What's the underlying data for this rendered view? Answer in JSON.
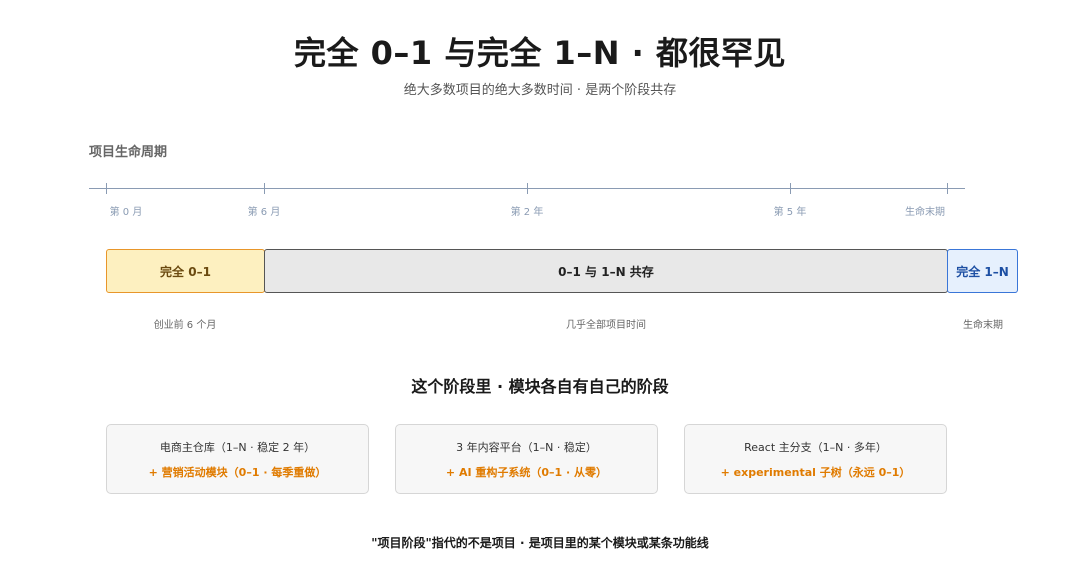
{
  "header": {
    "title": "完全 0–1 与完全 1–N · 都很罕见",
    "subtitle": "绝大多数项目的绝大多数时间 · 是两个阶段共存"
  },
  "timeline": {
    "label": "项目生命周期",
    "ticks": [
      "第 0 月",
      "第 6 月",
      "第 2 年",
      "第 5 年",
      "生命末期"
    ]
  },
  "phases": [
    {
      "label": "完全 0–1",
      "caption": "创业前 6 个月"
    },
    {
      "label": "0–1 与 1–N 共存",
      "caption": "几乎全部项目时间"
    },
    {
      "label": "完全 1–N",
      "caption": "生命末期"
    }
  ],
  "modules": {
    "heading": "这个阶段里 · 模块各自有自己的阶段",
    "cards": [
      {
        "line1": "电商主仓库（1–N · 稳定 2 年）",
        "line2": "+ 营销活动模块（0–1 · 每季重做）"
      },
      {
        "line1": "3 年内容平台（1–N · 稳定）",
        "line2": "+ AI 重构子系统（0–1 · 从零）"
      },
      {
        "line1": "React 主分支（1–N · 多年）",
        "line2": "+ experimental 子树（永远 0–1）"
      }
    ]
  },
  "footer": {
    "note": "\"项目阶段\"指代的不是项目 · 是项目里的某个模块或某条功能线"
  },
  "colors": {
    "phase_0_1": "#fdf0c0",
    "phase_0_1_border": "#e8962a",
    "phase_coexist": "#e8e8e8",
    "phase_1_n": "#e6f0fd",
    "phase_1_n_border": "#3a76d8",
    "accent_orange": "#e07b00",
    "axis": "#8a9bb3"
  }
}
